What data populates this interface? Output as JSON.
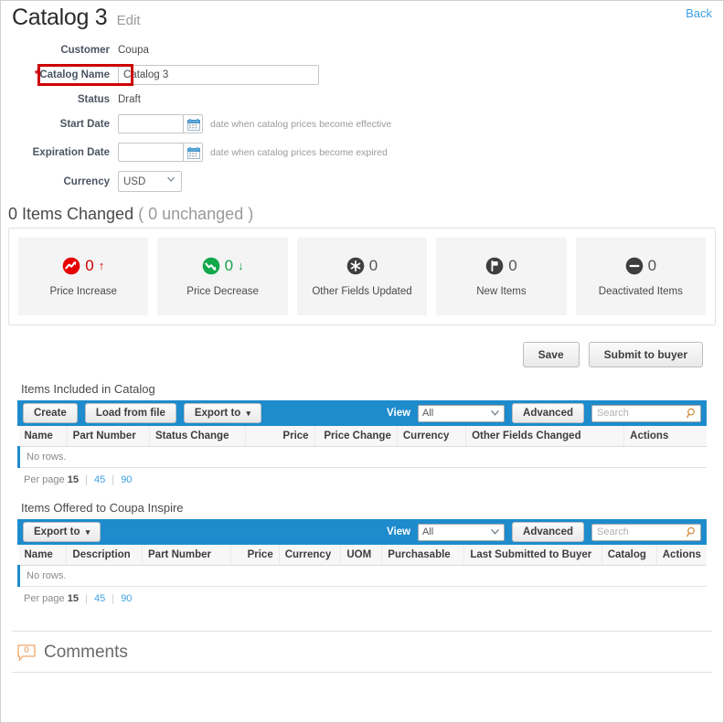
{
  "header": {
    "title": "Catalog 3",
    "subtitle": "Edit",
    "back_label": "Back"
  },
  "form": {
    "customer_label": "Customer",
    "customer_value": "Coupa",
    "catalog_name_label": "Catalog Name",
    "catalog_name_required_marker": "*",
    "catalog_name_value": "Catalog 3",
    "status_label": "Status",
    "status_value": "Draft",
    "start_date_label": "Start Date",
    "start_date_value": "",
    "start_date_hint": "date when catalog prices become effective",
    "expiration_date_label": "Expiration Date",
    "expiration_date_value": "",
    "expiration_date_hint": "date when catalog prices become expired",
    "currency_label": "Currency",
    "currency_value": "USD"
  },
  "items_changed": {
    "heading_count": "0 Items Changed",
    "heading_unchanged": "( 0 unchanged )",
    "cards": [
      {
        "count": "0",
        "arrow": "↑",
        "label": "Price Increase",
        "color": "#cc0000",
        "icon": "trend-up-icon"
      },
      {
        "count": "0",
        "arrow": "↓",
        "label": "Price Decrease",
        "color": "#16a34a",
        "icon": "trend-down-icon"
      },
      {
        "count": "0",
        "arrow": "",
        "label": "Other Fields Updated",
        "color": "#444444",
        "icon": "asterisk-icon"
      },
      {
        "count": "0",
        "arrow": "",
        "label": "New Items",
        "color": "#444444",
        "icon": "flag-icon"
      },
      {
        "count": "0",
        "arrow": "",
        "label": "Deactivated Items",
        "color": "#444444",
        "icon": "minus-icon"
      }
    ]
  },
  "actions": {
    "save_label": "Save",
    "submit_label": "Submit to buyer"
  },
  "table_included": {
    "title": "Items Included in Catalog",
    "toolbar": {
      "create_label": "Create",
      "load_label": "Load from file",
      "export_label": "Export to",
      "view_label": "View",
      "view_value": "All",
      "advanced_label": "Advanced",
      "search_placeholder": "Search",
      "search_value": ""
    },
    "columns": [
      {
        "label": "Name",
        "align": "l"
      },
      {
        "label": "Part Number",
        "align": "l"
      },
      {
        "label": "Status Change",
        "align": "l"
      },
      {
        "label": "Price",
        "align": "r"
      },
      {
        "label": "Price Change",
        "align": "r"
      },
      {
        "label": "Currency",
        "align": "l"
      },
      {
        "label": "Other Fields Changed",
        "align": "l"
      },
      {
        "label": "Actions",
        "align": "l"
      }
    ],
    "empty_text": "No rows.",
    "per_page_label": "Per page",
    "per_page_options": [
      "15",
      "45",
      "90"
    ],
    "per_page_selected": "15"
  },
  "table_offered": {
    "title": "Items Offered to Coupa Inspire",
    "toolbar": {
      "export_label": "Export to",
      "view_label": "View",
      "view_value": "All",
      "advanced_label": "Advanced",
      "search_placeholder": "Search",
      "search_value": ""
    },
    "columns": [
      {
        "label": "Name",
        "align": "l"
      },
      {
        "label": "Description",
        "align": "l"
      },
      {
        "label": "Part Number",
        "align": "l"
      },
      {
        "label": "Price",
        "align": "r"
      },
      {
        "label": "Currency",
        "align": "l"
      },
      {
        "label": "UOM",
        "align": "l"
      },
      {
        "label": "Purchasable",
        "align": "l"
      },
      {
        "label": "Last Submitted to Buyer",
        "align": "l"
      },
      {
        "label": "Catalog",
        "align": "l"
      },
      {
        "label": "Actions",
        "align": "l"
      }
    ],
    "empty_text": "No rows.",
    "per_page_label": "Per page",
    "per_page_options": [
      "15",
      "45",
      "90"
    ],
    "per_page_selected": "15"
  },
  "comments": {
    "title": "Comments",
    "count": "0"
  },
  "colors": {
    "toolbar_blue": "#1e8bcd",
    "link_blue": "#3da0e3",
    "required_red": "#d0021b",
    "highlight_red": "#cc0000",
    "increase_red": "#cc0000",
    "decrease_green": "#16a34a"
  }
}
